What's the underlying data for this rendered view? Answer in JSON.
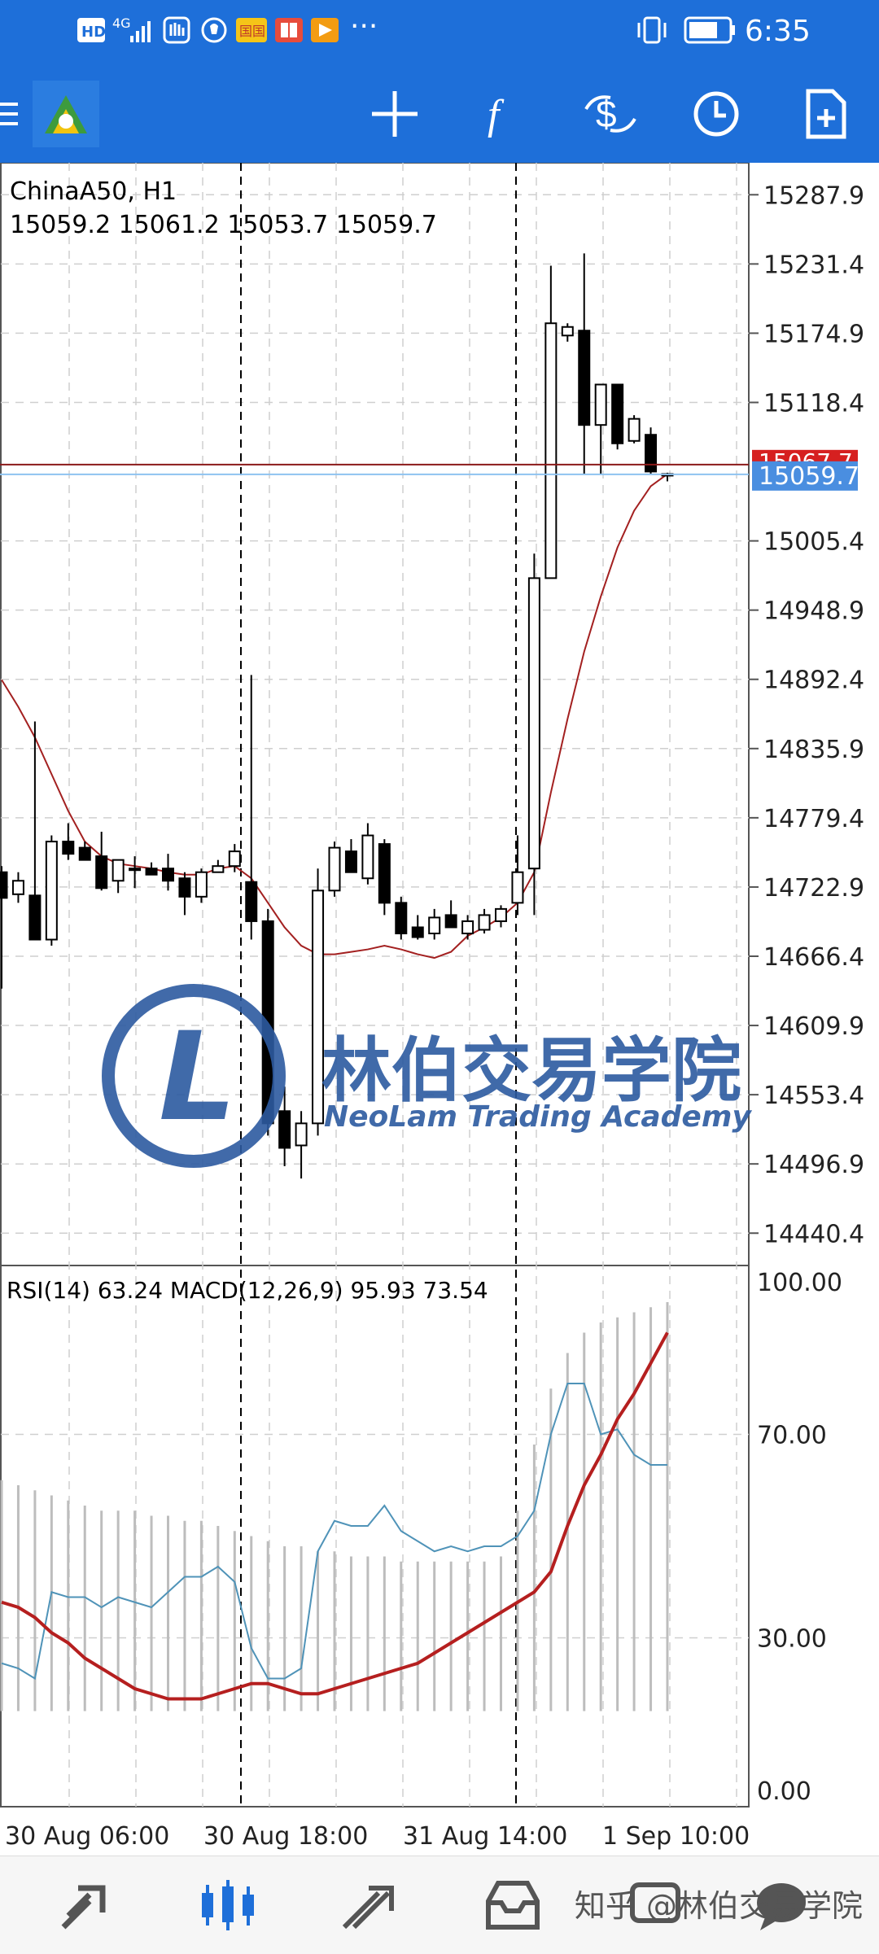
{
  "status_bar": {
    "network_left": "HD",
    "network_gen": "4G",
    "app_badge": "国国",
    "more": "···",
    "time": "6:35"
  },
  "toolbar": {
    "icons": [
      "menu-icon",
      "app-logo-icon",
      "crosshair-icon",
      "function-icon",
      "trade-icon",
      "clock-icon",
      "add-document-icon"
    ]
  },
  "chart": {
    "symbol_label": "ChinaA50, H1",
    "ohlc": "15059.2 15061.2 15053.7 15059.7",
    "price_ticks": [
      "15287.9",
      "15231.4",
      "15174.9",
      "15118.4",
      "15005.4",
      "14948.9",
      "14892.4",
      "14835.9",
      "14779.4",
      "14722.9",
      "14666.4",
      "14609.9",
      "14553.4",
      "14496.9",
      "14440.4"
    ],
    "hidden_price": "15067.7",
    "current_price": "15059.7",
    "indicator_label": "RSI(14) 63.24 MACD(12,26,9) 95.93 73.54",
    "indicator_ticks": [
      "100.00",
      "70.00",
      "30.00",
      "0.00"
    ],
    "time_labels": [
      "30 Aug 06:00",
      "30 Aug 18:00",
      "31 Aug 14:00",
      "1 Sep 10:00"
    ],
    "colors": {
      "bear_candle": "#000000",
      "bull_candle": "#ffffff",
      "ma_line": "#a32020",
      "bid_line": "#8b1a1a",
      "ask_line": "#8ec3f0",
      "current_price_bg": "#4a8ee0",
      "hidden_price_bg": "#d62020",
      "rsi_line": "#4f93b8",
      "signal_line": "#b51f1f"
    }
  },
  "chart_data": {
    "type": "candlestick",
    "title": "ChinaA50, H1",
    "candles": [
      {
        "o": 14735,
        "h": 14740,
        "l": 14640,
        "c": 14714
      },
      {
        "o": 14717,
        "h": 14735,
        "l": 14710,
        "c": 14728
      },
      {
        "o": 14716,
        "h": 14858,
        "l": 14680,
        "c": 14680
      },
      {
        "o": 14680,
        "h": 14765,
        "l": 14675,
        "c": 14760
      },
      {
        "o": 14760,
        "h": 14775,
        "l": 14745,
        "c": 14750
      },
      {
        "o": 14755,
        "h": 14760,
        "l": 14745,
        "c": 14745
      },
      {
        "o": 14748,
        "h": 14768,
        "l": 14720,
        "c": 14722
      },
      {
        "o": 14728,
        "h": 14745,
        "l": 14718,
        "c": 14745
      },
      {
        "o": 14738,
        "h": 14748,
        "l": 14722,
        "c": 14738
      },
      {
        "o": 14738,
        "h": 14743,
        "l": 14733,
        "c": 14733
      },
      {
        "o": 14738,
        "h": 14750,
        "l": 14720,
        "c": 14728
      },
      {
        "o": 14730,
        "h": 14735,
        "l": 14700,
        "c": 14715
      },
      {
        "o": 14715,
        "h": 14738,
        "l": 14710,
        "c": 14735
      },
      {
        "o": 14735,
        "h": 14745,
        "l": 14735,
        "c": 14740
      },
      {
        "o": 14740,
        "h": 14758,
        "l": 14735,
        "c": 14752
      },
      {
        "o": 14727,
        "h": 14896,
        "l": 14680,
        "c": 14695
      },
      {
        "o": 14695,
        "h": 14705,
        "l": 14520,
        "c": 14530
      },
      {
        "o": 14540,
        "h": 14560,
        "l": 14495,
        "c": 14510
      },
      {
        "o": 14512,
        "h": 14540,
        "l": 14485,
        "c": 14530
      },
      {
        "o": 14530,
        "h": 14738,
        "l": 14520,
        "c": 14720
      },
      {
        "o": 14720,
        "h": 14760,
        "l": 14715,
        "c": 14755
      },
      {
        "o": 14752,
        "h": 14762,
        "l": 14735,
        "c": 14735
      },
      {
        "o": 14730,
        "h": 14775,
        "l": 14725,
        "c": 14765
      },
      {
        "o": 14758,
        "h": 14762,
        "l": 14700,
        "c": 14710
      },
      {
        "o": 14710,
        "h": 14715,
        "l": 14680,
        "c": 14685
      },
      {
        "o": 14690,
        "h": 14700,
        "l": 14680,
        "c": 14682
      },
      {
        "o": 14685,
        "h": 14705,
        "l": 14680,
        "c": 14698
      },
      {
        "o": 14700,
        "h": 14712,
        "l": 14690,
        "c": 14690
      },
      {
        "o": 14685,
        "h": 14700,
        "l": 14680,
        "c": 14695
      },
      {
        "o": 14688,
        "h": 14705,
        "l": 14685,
        "c": 14700
      },
      {
        "o": 14695,
        "h": 14708,
        "l": 14690,
        "c": 14705
      },
      {
        "o": 14710,
        "h": 14765,
        "l": 14700,
        "c": 14735
      },
      {
        "o": 14738,
        "h": 14995,
        "l": 14700,
        "c": 14975
      },
      {
        "o": 14975,
        "h": 15230,
        "l": 14975,
        "c": 15183
      },
      {
        "o": 15173,
        "h": 15183,
        "l": 15168,
        "c": 15180
      },
      {
        "o": 15177,
        "h": 15240,
        "l": 15060,
        "c": 15100
      },
      {
        "o": 15100,
        "h": 15130,
        "l": 15060,
        "c": 15133
      },
      {
        "o": 15133,
        "h": 15133,
        "l": 15080,
        "c": 15085
      },
      {
        "o": 15087,
        "h": 15108,
        "l": 15085,
        "c": 15105
      },
      {
        "o": 15092,
        "h": 15098,
        "l": 15060,
        "c": 15062
      },
      {
        "o": 15059,
        "h": 15061,
        "l": 15054,
        "c": 15060
      }
    ],
    "ma": [
      14892,
      14870,
      14845,
      14815,
      14785,
      14760,
      14748,
      14742,
      14740,
      14738,
      14735,
      14733,
      14733,
      14738,
      14740,
      14730,
      14710,
      14690,
      14675,
      14668,
      14668,
      14670,
      14672,
      14675,
      14672,
      14668,
      14665,
      14670,
      14683,
      14690,
      14698,
      14710,
      14735,
      14800,
      14860,
      14915,
      14960,
      15000,
      15030,
      15050,
      15060
    ],
    "rsi": [
      25,
      24,
      22,
      39,
      38,
      38,
      36,
      38,
      37,
      36,
      39,
      42,
      42,
      44,
      41,
      28,
      22,
      22,
      24,
      47,
      53,
      52,
      52,
      56,
      51,
      49,
      47,
      48,
      47,
      48,
      48,
      50,
      55,
      70,
      80,
      80,
      70,
      71,
      66,
      64,
      64
    ],
    "rsi_signal": [
      37,
      36,
      34,
      31,
      29,
      26,
      24,
      22,
      20,
      19,
      18,
      18,
      18,
      19,
      20,
      21,
      21,
      20,
      19,
      19,
      20,
      21,
      22,
      23,
      24,
      25,
      27,
      29,
      31,
      33,
      35,
      37,
      39,
      43,
      52,
      60,
      66,
      73,
      78,
      84,
      90
    ],
    "macd": [
      61,
      60,
      59,
      58,
      57,
      56,
      55,
      55,
      55,
      54,
      54,
      53,
      53,
      52,
      51,
      50,
      49,
      48,
      48,
      47,
      47,
      46,
      46,
      46,
      45,
      45,
      45,
      45,
      45,
      45,
      46,
      55,
      68,
      79,
      86,
      90,
      92,
      93,
      94,
      95,
      96
    ],
    "macd_signal": [
      70,
      69,
      68,
      67,
      66,
      66,
      65,
      64,
      64,
      63,
      62,
      62,
      61,
      60,
      60,
      59,
      58,
      57,
      56,
      56,
      55,
      55,
      54,
      54,
      54,
      53,
      53,
      53,
      53,
      53,
      53,
      54,
      56,
      59,
      63,
      66,
      68,
      70,
      72,
      73,
      74
    ],
    "y_range": [
      14414,
      15314
    ],
    "indicator_range": [
      0,
      100
    ],
    "x_labels": [
      "30 Aug 06:00",
      "30 Aug 18:00",
      "31 Aug 14:00",
      "1 Sep 10:00"
    ]
  },
  "watermark": {
    "cn": "林伯交易学院",
    "en": "NeoLam Trading Academy"
  },
  "bottom_nav": {
    "items": [
      "quotes-icon",
      "chart-icon",
      "trade-icon",
      "history-icon",
      "messages-icon",
      "chat-icon"
    ],
    "footer_watermark": "知乎 @林伯交易学院"
  }
}
